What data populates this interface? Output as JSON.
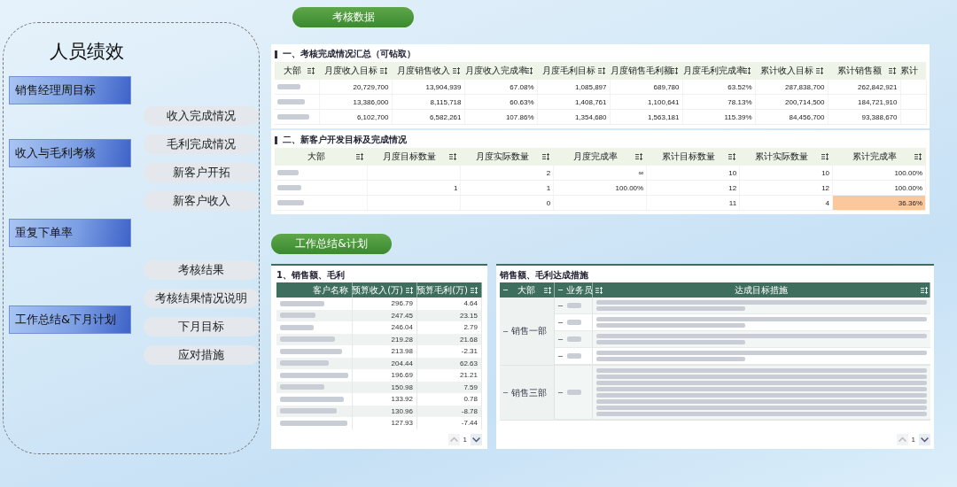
{
  "sidebar": {
    "title": "人员绩效",
    "sections": [
      {
        "label": "销售经理周目标"
      },
      {
        "label": "收入与毛利考核",
        "items": [
          "收入完成情况",
          "毛利完成情况",
          "新客户开拓",
          "新客户收入"
        ]
      },
      {
        "label": "重复下单率"
      },
      {
        "label": "工作总结&下月计划",
        "items": [
          "考核结果",
          "考核结果情况说明",
          "下月目标",
          "应对措施"
        ]
      }
    ]
  },
  "assessment": {
    "button": "考核数据",
    "summary": {
      "title": "一、考核完成情况汇总（可钻取）",
      "columns": [
        "大部",
        "月度收入目标",
        "月度销售收入",
        "月度收入完成率",
        "月度毛利目标",
        "月度销售毛利额",
        "月度毛利完成率",
        "累计收入目标",
        "累计销售额",
        "累计"
      ],
      "rows": [
        {
          "cells": [
            null,
            "20,729,700",
            "13,904,939",
            "67.08%",
            "1,085,897",
            "689,780",
            "63.52%",
            "287,838,700",
            "262,842,921"
          ]
        },
        {
          "cells": [
            null,
            "13,386,000",
            "8,115,718",
            "60.63%",
            "1,408,761",
            "1,100,641",
            "78.13%",
            "200,714,500",
            "184,721,910"
          ]
        },
        {
          "cells": [
            null,
            "6,102,700",
            "6,582,261",
            "107.86%",
            "1,354,680",
            "1,563,181",
            "115.39%",
            "84,456,700",
            "93,388,670"
          ]
        }
      ]
    },
    "new_customers": {
      "title": "二、新客户开发目标及完成情况",
      "columns": [
        "大部",
        "月度目标数量",
        "月度实际数量",
        "月度完成率",
        "累计目标数量",
        "累计实际数量",
        "累计完成率"
      ],
      "rows": [
        {
          "alert": false,
          "cells": [
            null,
            null,
            "2",
            "∞",
            "10",
            "10",
            "100.00%"
          ]
        },
        {
          "alert": false,
          "cells": [
            null,
            "1",
            "1",
            "100.00%",
            "12",
            "12",
            "100.00%"
          ]
        },
        {
          "alert": true,
          "cells": [
            null,
            null,
            "0",
            null,
            "11",
            "4",
            "36.36%"
          ]
        }
      ]
    }
  },
  "work": {
    "button": "工作总结&计划",
    "sales_table": {
      "title": "1、销售额、毛利",
      "columns": [
        "客户名称",
        "预算收入(万)",
        "预算毛利(万)"
      ],
      "rows": [
        [
          "296.79",
          "4.64"
        ],
        [
          "247.45",
          "23.15"
        ],
        [
          "246.04",
          "2.79"
        ],
        [
          "219.28",
          "21.68"
        ],
        [
          "213.98",
          "-2.31"
        ],
        [
          "204.44",
          "62.63"
        ],
        [
          "196.69",
          "21.21"
        ],
        [
          "150.98",
          "7.59"
        ],
        [
          "133.92",
          "0.78"
        ],
        [
          "130.96",
          "-8.78"
        ],
        [
          "127.93",
          "-7.44"
        ]
      ],
      "page": "1"
    },
    "measures": {
      "title": "销售额、毛利达成措施",
      "columns": [
        "大部",
        "业务员",
        "达成目标措施"
      ],
      "groups": [
        {
          "name": "销售一部",
          "expanded": true,
          "children": [
            {
              "expanded": true
            },
            {
              "expanded": true
            },
            {
              "expanded": true
            },
            {
              "expanded": true
            }
          ]
        },
        {
          "name": "销售三部",
          "expanded": true,
          "children": [
            {
              "expanded": true
            }
          ]
        }
      ],
      "page": "1"
    }
  }
}
